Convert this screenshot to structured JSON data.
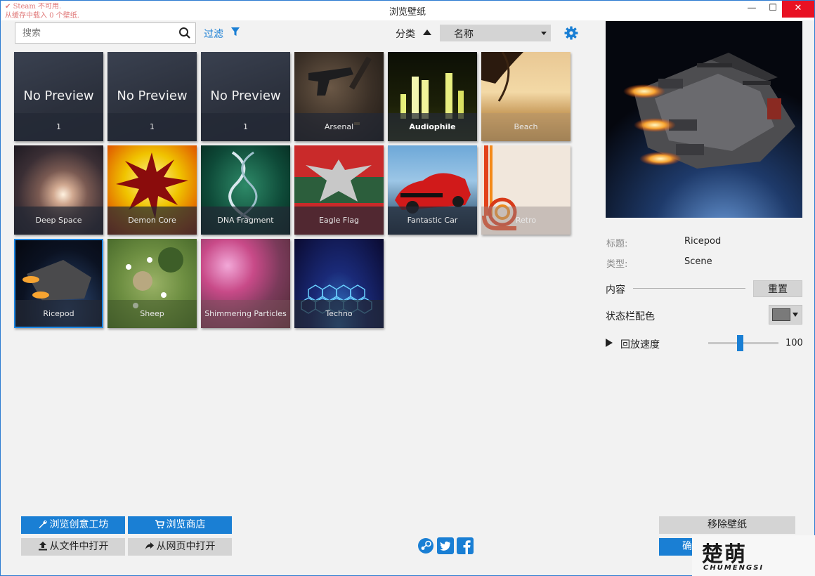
{
  "window": {
    "title": "浏览壁纸",
    "steam_warning_line1": "Steam 不可用.",
    "steam_warning_line2": "从缓存中载入 0 个壁纸.",
    "controls": {
      "minimize": "—",
      "maximize": "☐",
      "close": "✕"
    }
  },
  "toolbar": {
    "search_placeholder": "搜索",
    "filter_label": "过滤",
    "sort_label": "分类",
    "sort_value": "名称"
  },
  "wallpapers": [
    {
      "label": "1",
      "no_preview": "No Preview"
    },
    {
      "label": "1",
      "no_preview": "No Preview"
    },
    {
      "label": "1",
      "no_preview": "No Preview"
    },
    {
      "label": "Arsenal"
    },
    {
      "label": "Audiophile"
    },
    {
      "label": "Beach"
    },
    {
      "label": "Deep Space"
    },
    {
      "label": "Demon Core"
    },
    {
      "label": "DNA Fragment"
    },
    {
      "label": "Eagle Flag"
    },
    {
      "label": "Fantastic Car"
    },
    {
      "label": "Retro"
    },
    {
      "label": "Ricepod",
      "selected": true
    },
    {
      "label": "Sheep"
    },
    {
      "label": "Shimmering Particles"
    },
    {
      "label": "Techno"
    }
  ],
  "details": {
    "title_key": "标题:",
    "title_value": "Ricepod",
    "type_key": "类型:",
    "type_value": "Scene",
    "content_label": "内容",
    "reset_label": "重置",
    "statusbar_color_label": "状态栏配色",
    "statusbar_color": "#7a7a7a",
    "playback_speed_label": "回放速度",
    "playback_speed_value": "100",
    "playback_speed_fraction": 0.45
  },
  "bottom": {
    "workshop_label": "浏览创意工坊",
    "store_label": "浏览商店",
    "open_file_label": "从文件中打开",
    "open_url_label": "从网页中打开",
    "remove_label": "移除壁纸",
    "confirm_label": "确",
    "social_icons": [
      "steam-icon",
      "twitter-icon",
      "facebook-icon"
    ]
  },
  "watermark": {
    "main": "楚萌",
    "sub": "CHUMENGSI"
  },
  "colors": {
    "accent": "#1a7fd4",
    "close": "#e81123",
    "selected_outline": "#1e88e5"
  }
}
